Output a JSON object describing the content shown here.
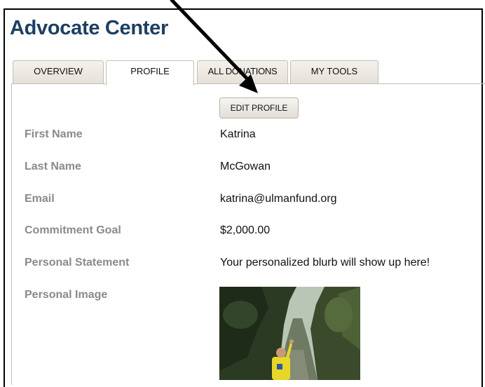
{
  "header": {
    "title": "Advocate Center"
  },
  "tabs": [
    {
      "label": "OVERVIEW"
    },
    {
      "label": "PROFILE"
    },
    {
      "label": "ALL DONATIONS"
    },
    {
      "label": "MY TOOLS"
    }
  ],
  "active_tab": "PROFILE",
  "profile": {
    "edit_label": "EDIT PROFILE",
    "fields": [
      {
        "label": "First Name",
        "value": "Katrina"
      },
      {
        "label": "Last Name",
        "value": "McGowan"
      },
      {
        "label": "Email",
        "value": "katrina@ulmanfund.org"
      },
      {
        "label": "Commitment Goal",
        "value": "$2,000.00"
      },
      {
        "label": "Personal Statement",
        "value": "Your personalized blurb will show up here!"
      },
      {
        "label": "Personal Image"
      }
    ]
  },
  "colors": {
    "title": "#1d3f63",
    "label": "#8a8a8a",
    "tab_bg": "#ebe7e0",
    "shirt": "#e8d628"
  },
  "icons": {
    "annotation": "arrow-pointer-icon"
  }
}
